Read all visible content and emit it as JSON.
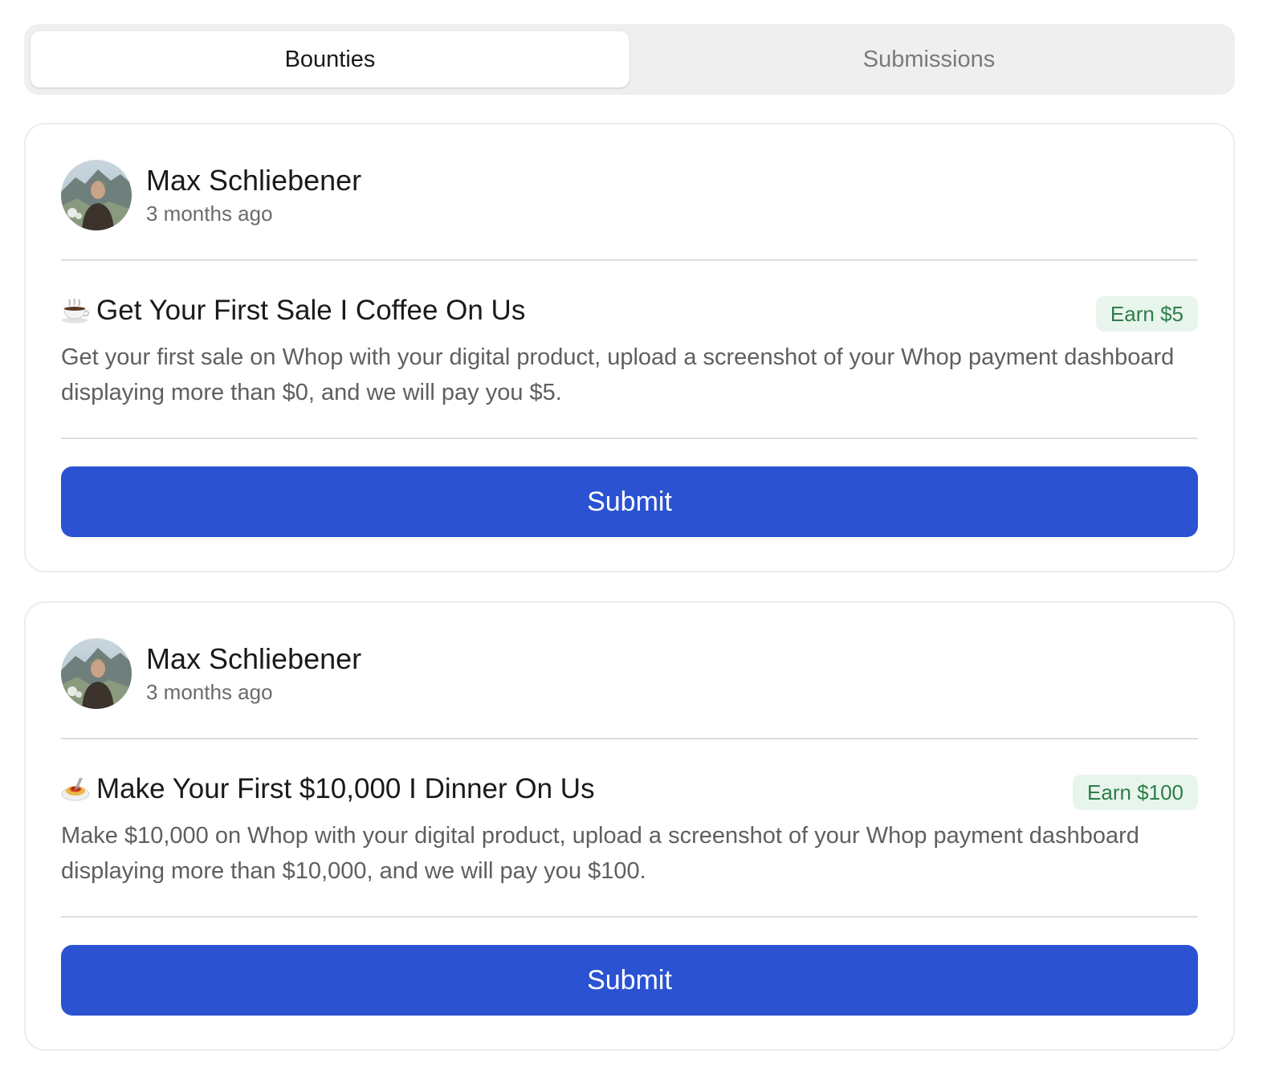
{
  "tabs": [
    {
      "label": "Bounties",
      "active": true
    },
    {
      "label": "Submissions",
      "active": false
    }
  ],
  "bounties": [
    {
      "author": {
        "name": "Max Schliebener",
        "time": "3 months ago"
      },
      "emoji_icon": "coffee-cup-icon",
      "title": "Get Your First Sale I Coffee On Us",
      "reward": "Earn $5",
      "description": "Get your first sale on Whop with your digital product, upload a screenshot of your Whop payment dashboard displaying more than $0, and we will pay you $5.",
      "button_label": "Submit"
    },
    {
      "author": {
        "name": "Max Schliebener",
        "time": "3 months ago"
      },
      "emoji_icon": "pasta-bowl-icon",
      "title": "Make Your First $10,000 I Dinner On Us",
      "reward": "Earn $100",
      "description": "Make $10,000 on Whop with your digital product, upload a screenshot of your Whop payment dashboard displaying more than $10,000, and we will pay you $100.",
      "button_label": "Submit"
    }
  ],
  "colors": {
    "primary_button": "#2b53d1",
    "earn_badge_bg": "#e8f5ec",
    "earn_badge_text": "#2e7d4a",
    "tab_bar_bg": "#efefef"
  }
}
